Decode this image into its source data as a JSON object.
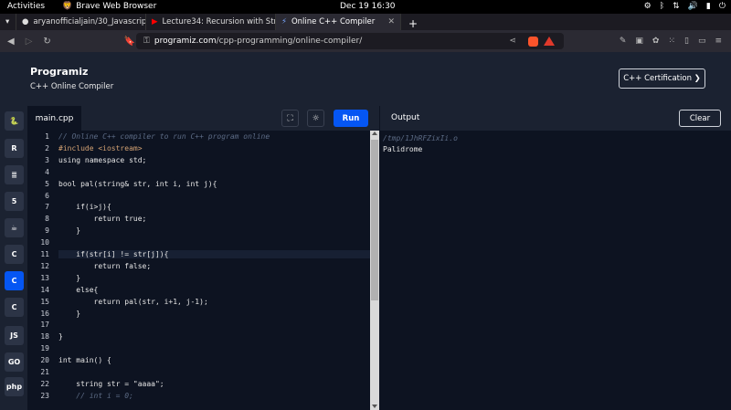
{
  "system": {
    "activities": "Activities",
    "app_name": "Brave Web Browser",
    "clock": "Dec 19  16:30"
  },
  "tabs": [
    {
      "label": "aryanofficialjain/30_Javascrip",
      "active": false
    },
    {
      "label": "Lecture34: Recursion with Str",
      "active": false
    },
    {
      "label": "Online C++ Compiler",
      "active": true
    }
  ],
  "address": {
    "host": "programiz.com",
    "path": "/cpp-programming/online-compiler/"
  },
  "header": {
    "logo": "Programiz",
    "subtitle": "C++ Online Compiler",
    "cert_button": "C++ Certification ❯"
  },
  "sidebar": [
    "py",
    "R",
    "db",
    "5",
    "java",
    "C",
    "C++",
    "C#",
    "JS",
    "GO",
    "php"
  ],
  "editor": {
    "file_tab": "main.cpp",
    "run_label": "Run",
    "lines": [
      {
        "n": "1",
        "text": "// Online C++ compiler to run C++ program online",
        "cls": "cmt"
      },
      {
        "n": "2",
        "text": "#include <iostream>",
        "cls": "inc"
      },
      {
        "n": "3",
        "text": "using namespace std;",
        "cls": ""
      },
      {
        "n": "4",
        "text": "",
        "cls": ""
      },
      {
        "n": "5",
        "text": "bool pal(string& str, int i, int j){",
        "cls": ""
      },
      {
        "n": "6",
        "text": "",
        "cls": ""
      },
      {
        "n": "7",
        "text": "    if(i>j){",
        "cls": ""
      },
      {
        "n": "8",
        "text": "        return true;",
        "cls": ""
      },
      {
        "n": "9",
        "text": "    }",
        "cls": ""
      },
      {
        "n": "10",
        "text": "",
        "cls": ""
      },
      {
        "n": "11",
        "text": "    if(str[i] != str[j]){",
        "cls": ""
      },
      {
        "n": "12",
        "text": "        return false;",
        "cls": ""
      },
      {
        "n": "13",
        "text": "    }",
        "cls": ""
      },
      {
        "n": "14",
        "text": "    else{",
        "cls": ""
      },
      {
        "n": "15",
        "text": "        return pal(str, i+1, j-1);",
        "cls": ""
      },
      {
        "n": "16",
        "text": "    }",
        "cls": ""
      },
      {
        "n": "17",
        "text": "",
        "cls": ""
      },
      {
        "n": "18",
        "text": "}",
        "cls": ""
      },
      {
        "n": "19",
        "text": "",
        "cls": ""
      },
      {
        "n": "20",
        "text": "int main() {",
        "cls": ""
      },
      {
        "n": "21",
        "text": "",
        "cls": ""
      },
      {
        "n": "22",
        "text": "    string str = \"aaaa\";",
        "cls": ""
      },
      {
        "n": "23",
        "text": "    // int i = 0;",
        "cls": "cmt"
      }
    ]
  },
  "output": {
    "title": "Output",
    "clear_label": "Clear",
    "path": "/tmp/1JhRFZixIi.o",
    "result": "Palidrome"
  }
}
